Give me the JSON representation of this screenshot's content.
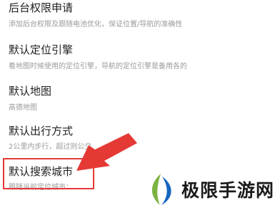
{
  "settings": [
    {
      "title": "后台权限申请",
      "desc": "添加后台权限及跟随电池优化，保证位置/导航的准确性"
    },
    {
      "title": "默认定位引擎",
      "desc": "看地图时候使用的定位引擎，导航的定位引擎是备用各的"
    },
    {
      "title": "默认地图",
      "desc": "高德地图"
    },
    {
      "title": "默认出行方式",
      "desc": "2公里内步行，超过则公交"
    },
    {
      "title": "默认搜索城市",
      "desc": "跟随当前定位城市："
    }
  ],
  "annotation": {
    "color": "#e53935",
    "arrow_icon": "red-arrow-icon"
  },
  "watermark": {
    "text": "极限手游网",
    "logo_icon": "leaf-logo-icon",
    "colors": [
      "#7cb342",
      "#1565c0"
    ]
  }
}
